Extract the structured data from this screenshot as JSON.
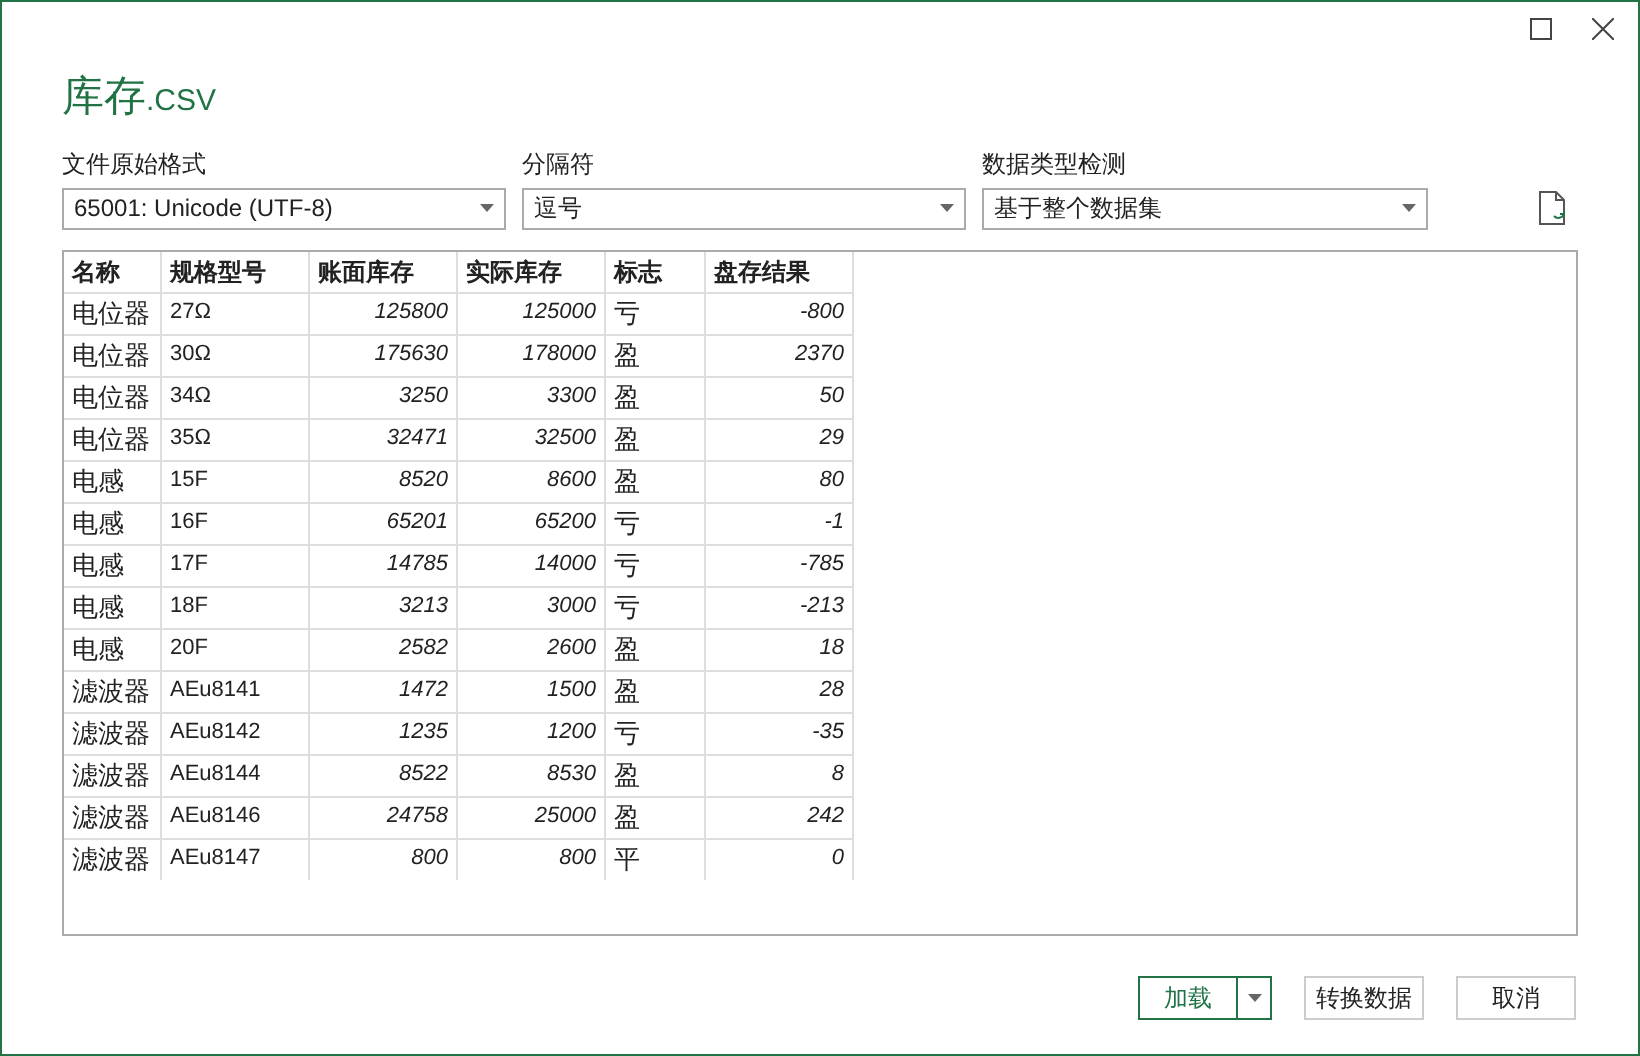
{
  "window": {
    "title_main": "库存",
    "title_ext": ".CSV"
  },
  "options": [
    {
      "label": "文件原始格式",
      "value": "65001: Unicode (UTF-8)"
    },
    {
      "label": "分隔符",
      "value": "逗号"
    },
    {
      "label": "数据类型检测",
      "value": "基于整个数据集"
    }
  ],
  "table": {
    "columns": [
      {
        "label": "名称",
        "kind": "text"
      },
      {
        "label": "规格型号",
        "kind": "text"
      },
      {
        "label": "账面库存",
        "kind": "number"
      },
      {
        "label": "实际库存",
        "kind": "number"
      },
      {
        "label": "标志",
        "kind": "text"
      },
      {
        "label": "盘存结果",
        "kind": "number"
      }
    ],
    "rows": [
      [
        "电位器",
        "27Ω",
        "125800",
        "125000",
        "亏",
        "-800"
      ],
      [
        "电位器",
        "30Ω",
        "175630",
        "178000",
        "盈",
        "2370"
      ],
      [
        "电位器",
        "34Ω",
        "3250",
        "3300",
        "盈",
        "50"
      ],
      [
        "电位器",
        "35Ω",
        "32471",
        "32500",
        "盈",
        "29"
      ],
      [
        "电感",
        "15F",
        "8520",
        "8600",
        "盈",
        "80"
      ],
      [
        "电感",
        "16F",
        "65201",
        "65200",
        "亏",
        "-1"
      ],
      [
        "电感",
        "17F",
        "14785",
        "14000",
        "亏",
        "-785"
      ],
      [
        "电感",
        "18F",
        "3213",
        "3000",
        "亏",
        "-213"
      ],
      [
        "电感",
        "20F",
        "2582",
        "2600",
        "盈",
        "18"
      ],
      [
        "滤波器",
        "AEu8141",
        "1472",
        "1500",
        "盈",
        "28"
      ],
      [
        "滤波器",
        "AEu8142",
        "1235",
        "1200",
        "亏",
        "-35"
      ],
      [
        "滤波器",
        "AEu8144",
        "8522",
        "8530",
        "盈",
        "8"
      ],
      [
        "滤波器",
        "AEu8146",
        "24758",
        "25000",
        "盈",
        "242"
      ],
      [
        "滤波器",
        "AEu8147",
        "800",
        "800",
        "平",
        "0"
      ]
    ]
  },
  "buttons": [
    {
      "label": "加载",
      "kind": "split"
    },
    {
      "label": "转换数据",
      "kind": "plain"
    },
    {
      "label": "取消",
      "kind": "plain"
    }
  ]
}
